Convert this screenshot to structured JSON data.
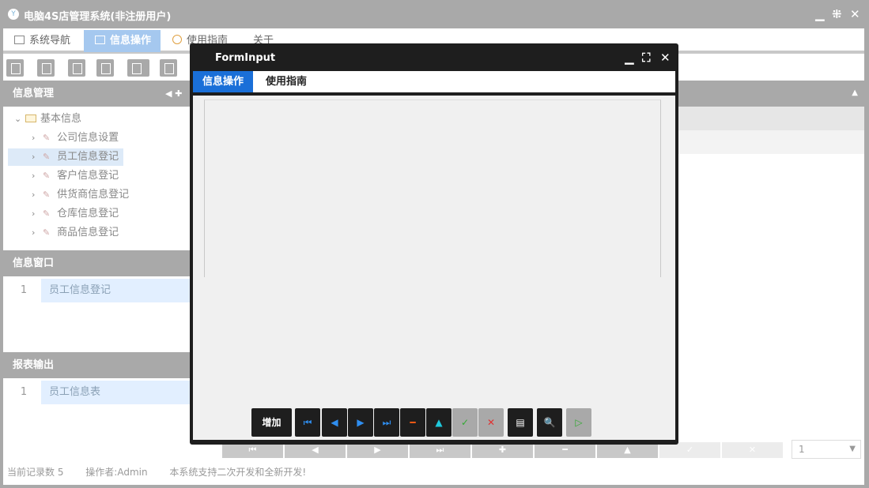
{
  "window": {
    "title": "电脑4S店管理系统(非注册用户)",
    "controls": {
      "minimize": "▁",
      "restore": "⁜",
      "close": "✕"
    }
  },
  "tabs": [
    {
      "label": "系统导航"
    },
    {
      "label": "信息操作"
    },
    {
      "label": "使用指南"
    },
    {
      "label": "关于"
    }
  ],
  "panels": {
    "info_mgmt": {
      "title": "信息管理",
      "nav": "◀ ✚"
    },
    "info_window": {
      "title": "信息窗口",
      "rows": [
        {
          "num": "1",
          "label": "员工信息登记"
        }
      ]
    },
    "report": {
      "title": "报表输出",
      "rows": [
        {
          "num": "1",
          "label": "员工信息表"
        }
      ]
    }
  },
  "tree": {
    "root": "基本信息",
    "items": [
      "公司信息设置",
      "员工信息登记",
      "客户信息登记",
      "供货商信息登记",
      "仓库信息登记",
      "商品信息登记"
    ]
  },
  "bottom_bar": {
    "buttons": [
      "⏮",
      "◀",
      "▶",
      "⏭",
      "✚",
      "━",
      "▲",
      "✓",
      "✕"
    ],
    "page_value": "1",
    "dropdown": "▼"
  },
  "status": {
    "records": "当前记录数 5",
    "operator": "操作者:Admin",
    "message": "本系统支持二次开发和全新开发!"
  },
  "dialog": {
    "title": "FormInput",
    "controls": {
      "minimize": "▁",
      "maximize": "⛶",
      "close": "✕"
    },
    "tabs": [
      "信息操作",
      "使用指南"
    ],
    "add_label": "增加",
    "nav_buttons": [
      "⏮",
      "◀",
      "▶",
      "⏭",
      "━",
      "▲",
      "✓",
      "✕",
      "▤",
      "🔍",
      "▷"
    ]
  },
  "colors": {
    "title_gray": "#a9a9a9",
    "tab_active": "#a5c8ef",
    "dialog_dark": "#1e1e1e",
    "dialog_tab_active": "#1a6fd8",
    "nav_blue": "#2f8ef0",
    "nav_orange": "#f05a14",
    "nav_cyan": "#1ec8dc",
    "nav_green": "#33aa33"
  }
}
